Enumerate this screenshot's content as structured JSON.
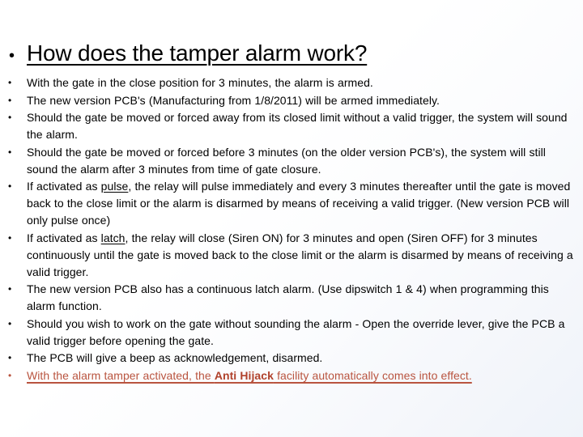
{
  "slide": {
    "title_bullet": "•",
    "title": "How does the tamper alarm work?",
    "bullet_marker": "•",
    "accent_color": "#b9543f",
    "accent_strong_color": "#b0412b",
    "body_color": "#000000",
    "bullets": [
      {
        "id": "armed-after-3-minutes",
        "text": "With the gate in the close position for 3 minutes, the alarm is armed."
      },
      {
        "id": "new-pcb-armed-immediately",
        "text": "The new version PCB's (Manufacturing from 1/8/2011) will be armed immediately."
      },
      {
        "id": "gate-forced-sounds-alarm",
        "text": "Should the gate be moved or forced away from its closed limit without a valid trigger, the system will sound the alarm."
      },
      {
        "id": "older-pcb-delayed-alarm",
        "text": "Should the gate be moved or forced before 3 minutes (on the older version PCB's), the system will still sound the alarm after 3 minutes from time of gate closure."
      },
      {
        "id": "pulse-mode",
        "pre": "If activated as ",
        "underlined": "pulse",
        "post": ", the relay will pulse immediately and every 3 minutes thereafter until the gate is moved back to the close limit or the alarm is disarmed by means of receiving a valid trigger. (New version PCB will only pulse once)"
      },
      {
        "id": "latch-mode",
        "pre": "If activated as ",
        "underlined": "latch",
        "post": ", the relay will close (Siren ON) for 3 minutes and open (Siren OFF) for 3 minutes continuously until the gate is moved back to the close limit or the alarm is disarmed by means of receiving a valid trigger."
      },
      {
        "id": "continuous-latch-dipswitch",
        "text": "The new version PCB also has a continuous latch alarm. (Use dipswitch 1 & 4) when programming this alarm function."
      },
      {
        "id": "override-lever-procedure",
        "text": "Should you wish to work on the gate without sounding the alarm - Open the override lever, give the PCB a valid trigger before opening the gate."
      },
      {
        "id": "beep-acknowledgement",
        "text": "The PCB will give a beep as  acknowledgement, disarmed."
      },
      {
        "id": "anti-hijack-note",
        "pre": "With the alarm tamper activated, the ",
        "strong": "Anti Hijack",
        "post": " facility automatically comes into effect."
      }
    ]
  }
}
